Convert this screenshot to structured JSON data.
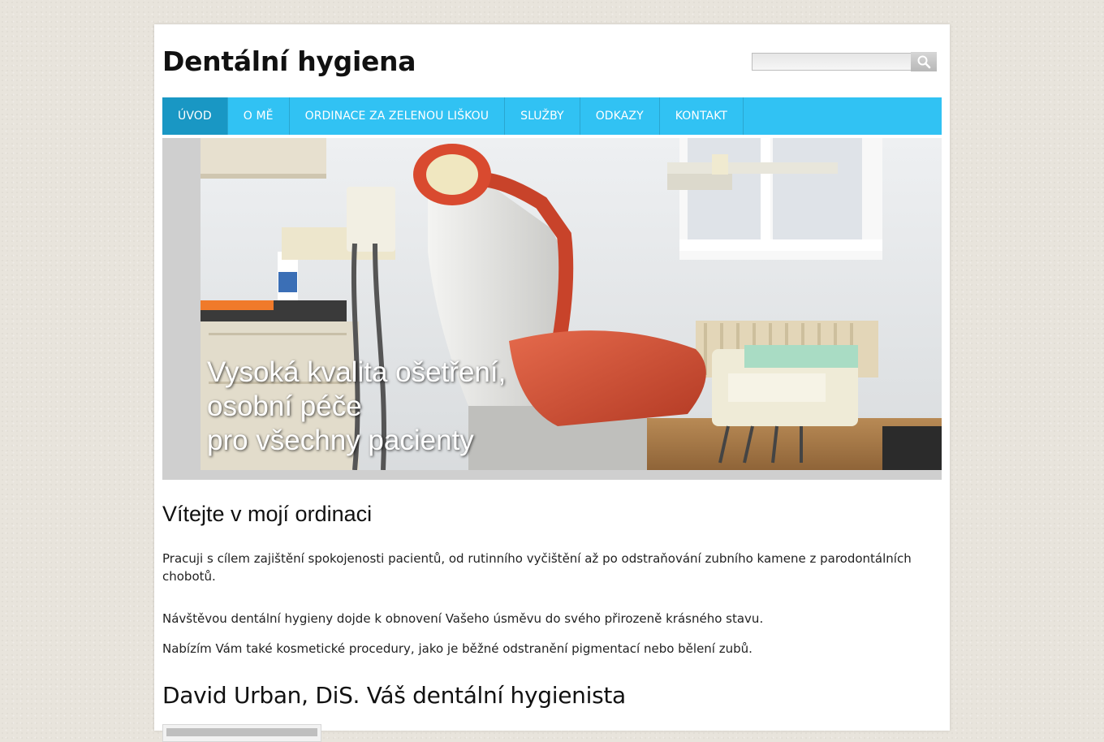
{
  "site": {
    "title": "Dentální hygiena"
  },
  "search": {
    "value": "",
    "button_icon": "search-icon"
  },
  "nav": {
    "items": [
      {
        "label": "ÚVOD",
        "active": true
      },
      {
        "label": "O MĚ",
        "active": false
      },
      {
        "label": "ORDINACE ZA ZELENOU LIŠKOU",
        "active": false
      },
      {
        "label": "SLUŽBY",
        "active": false
      },
      {
        "label": "ODKAZY",
        "active": false
      },
      {
        "label": "KONTAKT",
        "active": false
      }
    ]
  },
  "hero": {
    "caption_lines": [
      "Vysoká kvalita ošetření,",
      "osobní péče",
      "pro všechny pacienty"
    ]
  },
  "main": {
    "welcome_heading": "Vítejte v mojí ordinaci",
    "paragraphs": [
      "Pracuji s cílem zajištění spokojenosti pacientů, od rutinního vyčištění až po odstraňování zubního kamene z parodontálních chobotů.",
      "Návštěvou dentální hygieny dojde k obnovení Vašeho úsměvu do svého přirozeně krásného stavu.",
      "Nabízím Vám také kosmetické procedury, jako je běžné odstranění pigmentací nebo bělení zubů."
    ],
    "person_heading": "David Urban, DiS. Váš dentální hygienista"
  },
  "colors": {
    "nav_bg": "#31c2f3",
    "nav_active": "#1997c4",
    "page_bg": "#e8e4dc"
  }
}
